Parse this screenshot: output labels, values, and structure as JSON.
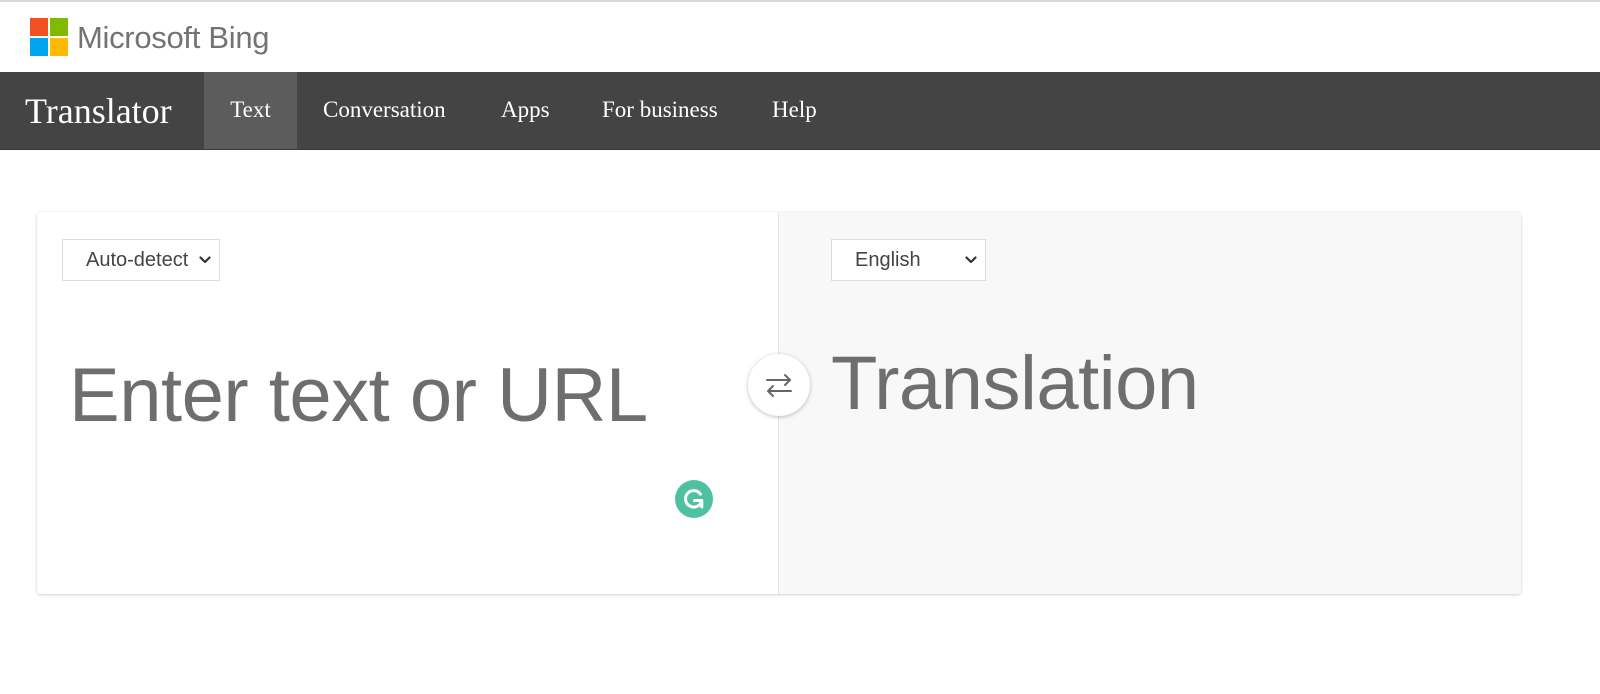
{
  "bing_header": {
    "logo_colors": [
      "#f25022",
      "#7fba00",
      "#00a4ef",
      "#ffb900"
    ],
    "title": "Microsoft Bing"
  },
  "nav": {
    "brand": "Translator",
    "items": [
      {
        "label": "Text",
        "active": true
      },
      {
        "label": "Conversation",
        "active": false
      },
      {
        "label": "Apps",
        "active": false
      },
      {
        "label": "For business",
        "active": false
      },
      {
        "label": "Help",
        "active": false
      }
    ]
  },
  "source": {
    "language": "Auto-detect",
    "placeholder": "Enter text or URL"
  },
  "target": {
    "language": "English",
    "placeholder": "Translation"
  },
  "icons": {
    "swap": "swap-arrows-icon",
    "grammarly": "grammarly-icon",
    "chevron": "chevron-down-icon"
  },
  "colors": {
    "navbar": "#444444",
    "nav_active": "#5c5c5c",
    "grammarly": "#4fc1a0",
    "target_pane": "#f8f8f8"
  }
}
